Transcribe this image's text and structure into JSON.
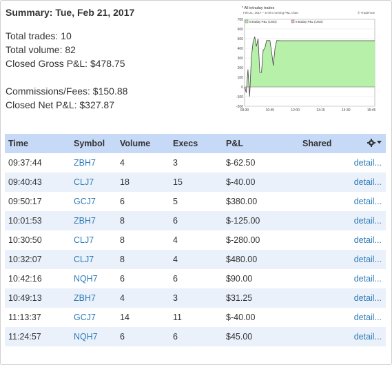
{
  "summary": {
    "title": "Summary: Tue, Feb 21, 2017",
    "total_trades": "Total trades: 10",
    "total_volume": "Total volume: 82",
    "closed_gross": "Closed Gross P&L: $478.75",
    "commissions": "Commissions/Fees: $150.88",
    "closed_net": "Closed Net P&L: $327.87"
  },
  "chart": {
    "header": "* All intraday trades",
    "subtitle": "Feb 21, 2017 – 5-min running P&L chart",
    "credit": "© Tradervue",
    "legend_pos": "Intraday P&L (USD)",
    "legend_neg": "Intraday P&L (USD)",
    "colors": {
      "pos_fill": "#b7f0a8",
      "neg_fill": "#f2b8b8",
      "line": "#444444",
      "grid": "#dddddd"
    }
  },
  "chart_data": {
    "type": "area",
    "x": [
      "09:30",
      "09:35",
      "09:40",
      "09:45",
      "09:50",
      "09:55",
      "10:00",
      "10:05",
      "10:10",
      "10:15",
      "10:20",
      "10:25",
      "10:30",
      "10:35",
      "10:40",
      "10:45",
      "10:50",
      "10:55",
      "11:00",
      "11:05",
      "11:10",
      "11:15",
      "11:20",
      "11:25",
      "11:30",
      "15:55"
    ],
    "y": [
      0,
      -60,
      180,
      -100,
      300,
      460,
      520,
      420,
      500,
      150,
      150,
      380,
      400,
      480,
      480,
      480,
      360,
      220,
      400,
      480,
      480,
      478.75,
      478.75,
      478.75,
      478.75,
      478.75
    ],
    "x_ticks": [
      "09:30",
      "10:45",
      "12:00",
      "13:15",
      "14:30",
      "15:45"
    ],
    "y_ticks": [
      -200,
      -100,
      0,
      100,
      200,
      300,
      400,
      500,
      600,
      700
    ],
    "ylim": [
      -200,
      700
    ],
    "grid": true,
    "legend": "top-left"
  },
  "table": {
    "headers": {
      "time": "Time",
      "symbol": "Symbol",
      "volume": "Volume",
      "execs": "Execs",
      "pnl": "P&L",
      "shared": "Shared"
    },
    "rows": [
      {
        "time": "09:37:44",
        "symbol": "ZBH7",
        "volume": "4",
        "execs": "3",
        "pnl": "$-62.50",
        "detail": "detail..."
      },
      {
        "time": "09:40:43",
        "symbol": "CLJ7",
        "volume": "18",
        "execs": "15",
        "pnl": "$-40.00",
        "detail": "detail..."
      },
      {
        "time": "09:50:17",
        "symbol": "GCJ7",
        "volume": "6",
        "execs": "5",
        "pnl": "$380.00",
        "detail": "detail..."
      },
      {
        "time": "10:01:53",
        "symbol": "ZBH7",
        "volume": "8",
        "execs": "6",
        "pnl": "$-125.00",
        "detail": "detail..."
      },
      {
        "time": "10:30:50",
        "symbol": "CLJ7",
        "volume": "8",
        "execs": "4",
        "pnl": "$-280.00",
        "detail": "detail..."
      },
      {
        "time": "10:32:07",
        "symbol": "CLJ7",
        "volume": "8",
        "execs": "4",
        "pnl": "$480.00",
        "detail": "detail..."
      },
      {
        "time": "10:42:16",
        "symbol": "NQH7",
        "volume": "6",
        "execs": "6",
        "pnl": "$90.00",
        "detail": "detail..."
      },
      {
        "time": "10:49:13",
        "symbol": "ZBH7",
        "volume": "4",
        "execs": "3",
        "pnl": "$31.25",
        "detail": "detail..."
      },
      {
        "time": "11:13:37",
        "symbol": "GCJ7",
        "volume": "14",
        "execs": "11",
        "pnl": "$-40.00",
        "detail": "detail..."
      },
      {
        "time": "11:24:57",
        "symbol": "NQH7",
        "volume": "6",
        "execs": "6",
        "pnl": "$45.00",
        "detail": "detail..."
      }
    ]
  }
}
